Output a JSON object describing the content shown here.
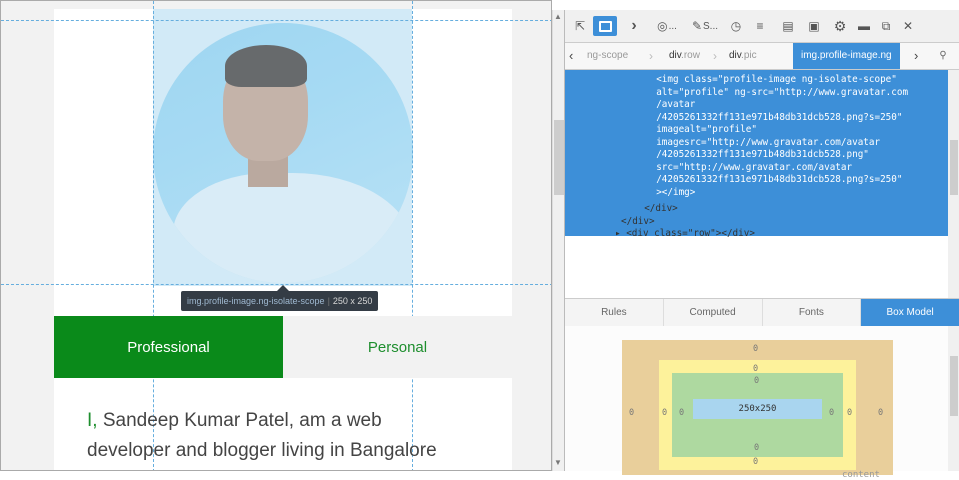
{
  "page": {
    "tooltip": {
      "selector": "img.profile-image.ng-isolate-scope",
      "dimensions": "250 x 250"
    },
    "tabs": [
      {
        "label": "Professional",
        "active": true
      },
      {
        "label": "Personal",
        "active": false
      }
    ],
    "bio": {
      "lead": "I,",
      "line1": " Sandeep Kumar Patel, am a web",
      "line2": "developer and blogger living in Bangalore"
    }
  },
  "devtools": {
    "toolbar": {
      "icons": [
        "pick-element-icon",
        "responsive-mode-icon",
        "console-icon",
        "debugger-icon",
        "style-editor-icon",
        "performance-icon",
        "network-icon",
        "storage-icon",
        "split-console-icon",
        "settings-icon",
        "dock-icon",
        "popout-icon",
        "close-icon"
      ],
      "style_label": "S...",
      "more_label": "..."
    },
    "breadcrumbs": [
      {
        "label": "ng-scope",
        "active": false
      },
      {
        "tag": "div",
        "cls": ".row",
        "active": false
      },
      {
        "tag": "div",
        "cls": ".pic",
        "active": false
      },
      {
        "label": "img.profile-image.ng",
        "active": true
      }
    ],
    "search_icon": "search-icon",
    "markup": {
      "lines": [
        {
          "text": "  <img class=\"profile-image ng-isolate-scope\"",
          "selected": true
        },
        {
          "text": "  alt=\"profile\" ng-src=\"http://www.gravatar.com",
          "selected": true
        },
        {
          "text": "  /avatar",
          "selected": true
        },
        {
          "text": "  /4205261332ff131e971b48db31dcb528.png?s=250\"",
          "selected": true
        },
        {
          "text": "  imagealt=\"profile\"",
          "selected": true
        },
        {
          "text": "  imagesrc=\"http://www.gravatar.com/avatar",
          "selected": true
        },
        {
          "text": "  /4205261332ff131e971b48db31dcb528.png\"",
          "selected": true
        },
        {
          "text": "  src=\"http://www.gravatar.com/avatar",
          "selected": true
        },
        {
          "text": "  /4205261332ff131e971b48db31dcb528.png?s=250\"",
          "selected": true
        },
        {
          "text": "  ></img>",
          "selected": true
        },
        {
          "text": "  </div>",
          "selected": false
        },
        {
          "text": "</div>",
          "selected": false
        },
        {
          "text": "▸ <div class=\"row\"></div>",
          "selected": false
        }
      ]
    },
    "subtabs": [
      {
        "label": "Rules",
        "active": false
      },
      {
        "label": "Computed",
        "active": false
      },
      {
        "label": "Fonts",
        "active": false
      },
      {
        "label": "Box Model",
        "active": true
      }
    ],
    "box_model": {
      "margin": "0",
      "border": "0",
      "padding": "0",
      "content_size": "250x250",
      "content_label": "content"
    }
  },
  "colors": {
    "accent_green": "#0a8a1a",
    "devtools_blue": "#3d8fd8",
    "box_margin": "#e9cf9b",
    "box_border": "#fdf29b",
    "box_padding": "#aed9a0",
    "box_content": "#a9d5ef"
  }
}
